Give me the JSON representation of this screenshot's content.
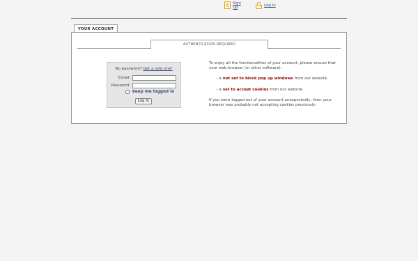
{
  "header": {
    "signup_label": "Sign Up",
    "login_label": "Log In",
    "signup_icon": "document-icon",
    "login_icon": "lock-icon"
  },
  "tab": {
    "label": "YOUR ACCOUNT"
  },
  "section": {
    "title": "AUTHENTICATION REQUIRED"
  },
  "login_form": {
    "forgot_text": "No password?",
    "forgot_link": "Get a new one!",
    "email_label": "Email:",
    "email_value": "",
    "password_label": "Password:",
    "password_value": "",
    "remember_label": "keep me logged in",
    "submit_label": "Log In"
  },
  "info": {
    "intro": "To enjoy all the functionalities of your account, please ensure that your web browser (or other software):",
    "bullet1_prefix": "- is ",
    "bullet1_highlight": "not set to block pop up windows",
    "bullet1_suffix": " from our website.",
    "bullet2_prefix": "- is ",
    "bullet2_highlight": "set to accept cookies",
    "bullet2_suffix": " from our website.",
    "outro": "If you were logged out of your account unexpectedly, then your browser was probably not accepting cookies previously."
  },
  "colors": {
    "link": "#3a4c80",
    "highlight": "#8b0000",
    "icon": "#e0a020"
  }
}
